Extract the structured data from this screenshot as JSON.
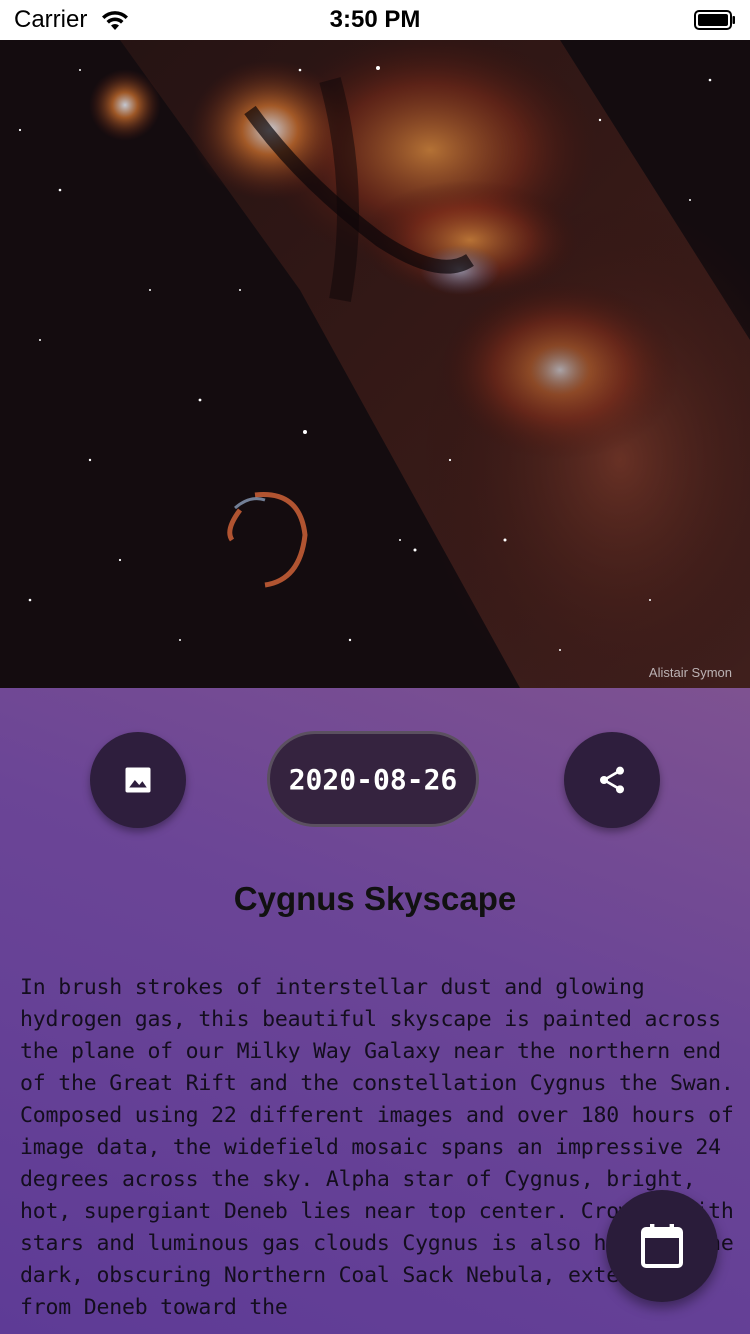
{
  "status_bar": {
    "carrier": "Carrier",
    "time": "3:50 PM"
  },
  "photo": {
    "credit": "Alistair Symon"
  },
  "actions": {
    "image_icon": "image-icon",
    "date": "2020-08-26",
    "share_icon": "share-icon"
  },
  "apod": {
    "title": "Cygnus Skyscape",
    "explanation": "In brush strokes of interstellar dust and glowing hydrogen gas, this beautiful skyscape is painted across the plane of our Milky Way Galaxy near the northern end of the Great Rift and the constellation Cygnus the Swan. Composed using 22 different images and over 180 hours of image data, the widefield mosaic spans an impressive 24 degrees across the sky. Alpha star of Cygnus, bright, hot, supergiant Deneb lies near top center. Crowded with stars and luminous gas clouds Cygnus is also home to the dark, obscuring Northern Coal Sack Nebula, extending from Deneb toward the"
  },
  "fab": {
    "icon": "calendar-icon"
  },
  "colors": {
    "panel_top": "#7e5291",
    "panel_bottom": "#5e3b96",
    "button_bg": "#2e1e3d"
  }
}
